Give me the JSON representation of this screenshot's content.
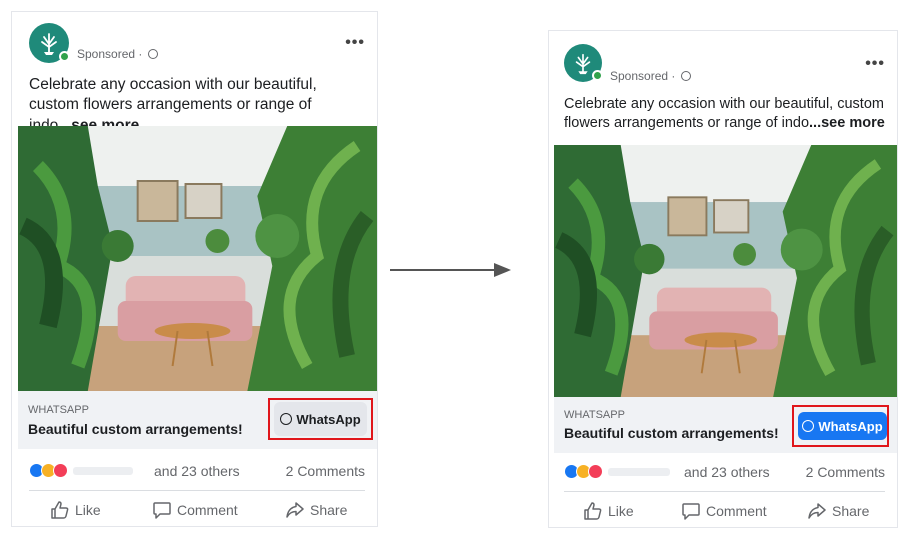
{
  "before": {
    "sponsored_label": "Sponsored ·",
    "caption_text": "Celebrate any occasion with our beautiful, custom flowers arrangements or range of indo",
    "see_more": "...see more",
    "cta_small": "WHATSAPP",
    "cta_title": "Beautiful custom arrangements!",
    "cta_button": "WhatsApp",
    "cta_button_color": "#e4e6eb",
    "others": "and 23 others",
    "comments": "2 Comments",
    "actions": {
      "like": "Like",
      "comment": "Comment",
      "share": "Share"
    }
  },
  "after": {
    "sponsored_label": "Sponsored ·",
    "caption_text": "Celebrate any occasion with our beautiful, custom flowers arrangements or range of indo",
    "see_more": "...see more",
    "cta_small": "WHATSAPP",
    "cta_title": "Beautiful custom arrangements!",
    "cta_button": "WhatsApp",
    "cta_button_color": "#1877f2",
    "others": "and 23 others",
    "comments": "2 Comments",
    "actions": {
      "like": "Like",
      "comment": "Comment",
      "share": "Share"
    }
  },
  "highlight_color": "#e0161b",
  "icons": [
    "plant-logo-icon",
    "globe-icon",
    "more-options-icon",
    "whatsapp-icon",
    "like-reaction-icon",
    "wow-reaction-icon",
    "love-reaction-icon",
    "thumbs-up-icon",
    "comment-icon",
    "share-icon",
    "arrow-right-icon"
  ]
}
